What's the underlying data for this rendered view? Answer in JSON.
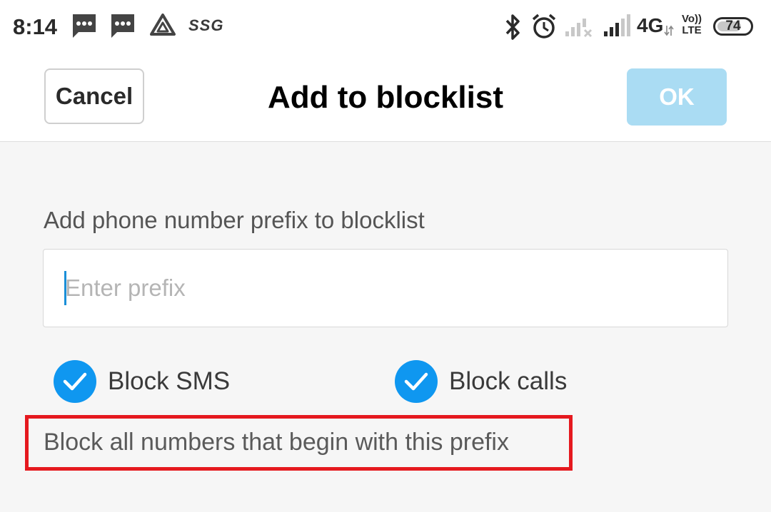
{
  "status_bar": {
    "time": "8:14",
    "carrier_tag": "SSG",
    "network": "4G",
    "volte_top": "Vo))",
    "volte_bottom": "LTE",
    "battery": "74",
    "battery_level": 0.74,
    "icons": [
      "message-icon",
      "message-icon",
      "drive-icon",
      "bluetooth-icon",
      "alarm-icon",
      "signal-icon",
      "signal-icon"
    ]
  },
  "header": {
    "cancel_label": "Cancel",
    "title": "Add to blocklist",
    "ok_label": "OK"
  },
  "form": {
    "prompt": "Add phone number prefix to blocklist",
    "prefix_value": "",
    "prefix_placeholder": "Enter prefix",
    "block_sms_label": "Block SMS",
    "block_sms_checked": true,
    "block_calls_label": "Block calls",
    "block_calls_checked": true,
    "hint": "Block all numbers that begin with this prefix"
  },
  "colors": {
    "accent": "#0f97f0",
    "ok_disabled": "#aadcf3",
    "highlight": "#e5191f"
  }
}
